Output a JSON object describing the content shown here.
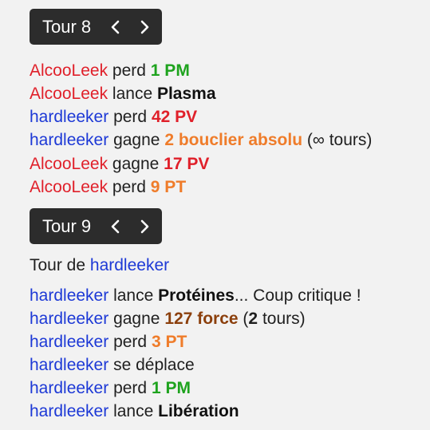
{
  "turn8": {
    "title": "Tour 8",
    "prev_icon": "chevron-left-icon",
    "next_icon": "chevron-right-icon"
  },
  "turn9": {
    "title": "Tour 9",
    "prev_icon": "chevron-left-icon",
    "next_icon": "chevron-right-icon"
  },
  "colors": {
    "player_red": "#e0202a",
    "player_blue": "#1d39d6",
    "pm_green": "#1ea31e",
    "pv_red": "#e0202a",
    "pt_orange": "#ef7c2a",
    "force_brown": "#8b3f0c",
    "header_bg": "#2c2c2c"
  },
  "log8": [
    {
      "actor": "AlcooLeek",
      "verb": "perd",
      "value": "1 PM"
    },
    {
      "actor": "AlcooLeek",
      "verb": "lance",
      "value": "Plasma"
    },
    {
      "actor": "hardleeker",
      "verb": "perd",
      "value": "42 PV"
    },
    {
      "actor": "hardleeker",
      "verb": "gagne",
      "value": "2 bouclier absolu",
      "open": "(",
      "infinity": "∞",
      "suffix": "tours)"
    },
    {
      "actor": "AlcooLeek",
      "verb": "gagne",
      "value": "17 PV"
    },
    {
      "actor": "AlcooLeek",
      "verb": "perd",
      "value": "9 PT"
    }
  ],
  "turn9_intro": {
    "prefix": "Tour de",
    "actor": "hardleeker"
  },
  "log9": [
    {
      "actor": "hardleeker",
      "verb": "lance",
      "value": "Protéines",
      "suffix": "... Coup critique !"
    },
    {
      "actor": "hardleeker",
      "verb": "gagne",
      "value": "127 force",
      "open": "(",
      "count": "2",
      "suffix": "tours)"
    },
    {
      "actor": "hardleeker",
      "verb": "perd",
      "value": "3 PT"
    },
    {
      "actor": "hardleeker",
      "verb": "se déplace"
    },
    {
      "actor": "hardleeker",
      "verb": "perd",
      "value": "1 PM"
    },
    {
      "actor": "hardleeker",
      "verb": "lance",
      "value": "Libération"
    }
  ]
}
